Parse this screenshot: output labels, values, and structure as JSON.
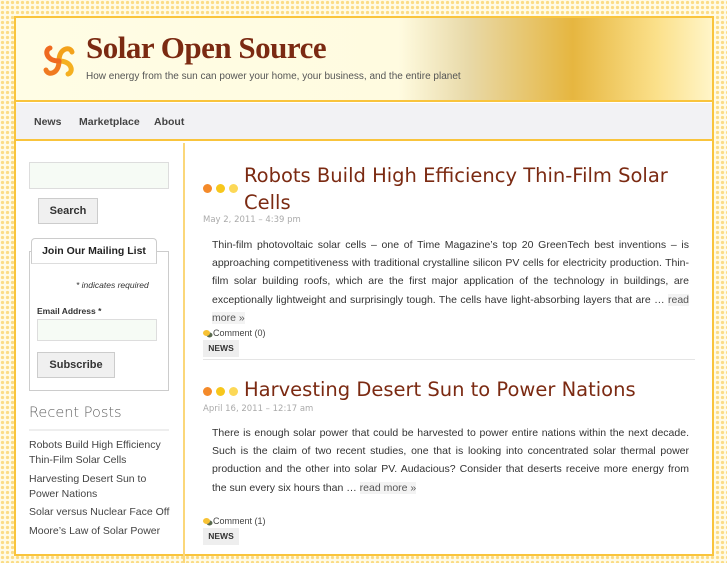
{
  "site": {
    "title": "Solar Open Source",
    "tagline": "How energy from the sun can power your home, your business, and the entire planet"
  },
  "nav": [
    {
      "label": "News"
    },
    {
      "label": "Marketplace"
    },
    {
      "label": "About"
    }
  ],
  "sidebar": {
    "search_value": "",
    "search_button": "Search",
    "mailing": {
      "legend": "Join Our Mailing List",
      "required_note": "* indicates required",
      "email_label": "Email Address *",
      "email_value": "",
      "subscribe": "Subscribe"
    },
    "recent_title": "Recent Posts",
    "recent": [
      "Robots Build High Efficiency Thin-Film Solar Cells",
      "Harvesting Desert Sun to Power Nations",
      "Solar versus Nuclear Face Off",
      "Moore’s Law of Solar Power"
    ]
  },
  "posts": [
    {
      "title": "Robots Build High Efficiency Thin-Film Solar Cells",
      "date": "May 2, 2011 – 4:39 pm",
      "excerpt": "Thin-film photovoltaic solar cells – one of Time Magazine’s top 20 GreenTech best inventions – is approaching competitiveness with traditional crystalline silicon PV cells for electricity production. Thin-film solar building roofs, which are the first major application of the technology in buildings, are exceptionally lightweight and surprisingly tough. The cells have light-absorbing layers that are … ",
      "more": "read more »",
      "comments": "Comment (0)",
      "category": "NEWS"
    },
    {
      "title": "Harvesting Desert Sun to Power Nations",
      "date": "April 16, 2011 – 12:17 am",
      "excerpt": "There is enough solar power that could be harvested to power entire nations within the next decade. Such is the claim of two recent studies, one that is looking into concentrated solar thermal power production and the other into solar PV. Audacious? Consider that deserts receive more energy from the sun every six hours than … ",
      "more": "read more »",
      "comments": "Comment (1)",
      "category": "NEWS"
    }
  ],
  "colors": {
    "accent": "#f9c43c",
    "title": "#7b2a12"
  }
}
